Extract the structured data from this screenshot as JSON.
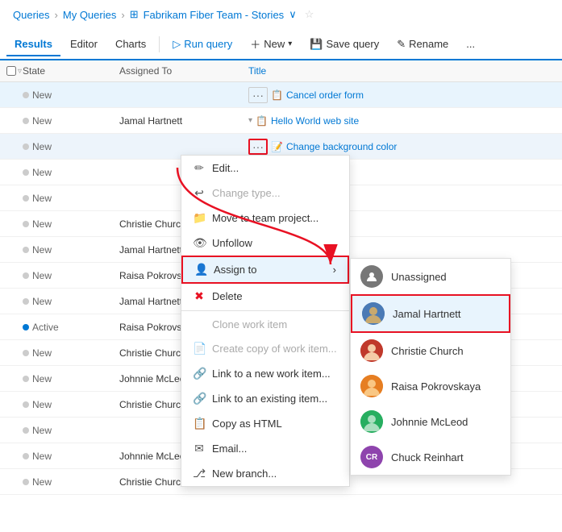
{
  "breadcrumb": {
    "item1": "Queries",
    "item2": "My Queries",
    "item3": "Fabrikam Fiber Team - Stories",
    "icon": "⊞"
  },
  "toolbar": {
    "results_tab": "Results",
    "editor_tab": "Editor",
    "charts_tab": "Charts",
    "run_query": "Run query",
    "new_label": "New",
    "save_query": "Save query",
    "rename": "Rename",
    "more": "..."
  },
  "table": {
    "col_state": "State",
    "col_assigned": "Assigned To",
    "col_title": "Title",
    "rows": [
      {
        "state": "New",
        "state_type": "grey",
        "assigned": "",
        "title": "Cancel order form",
        "icon": "story",
        "has_more": true
      },
      {
        "state": "New",
        "state_type": "grey",
        "assigned": "Jamal Hartnett",
        "title": "Hello World web site",
        "icon": "story",
        "has_more": false
      },
      {
        "state": "New",
        "state_type": "grey",
        "assigned": "",
        "title": "Change background color",
        "icon": "task",
        "has_more": true,
        "highlighted": true
      },
      {
        "state": "New",
        "state_type": "grey",
        "assigned": "",
        "title": "",
        "icon": "story",
        "has_more": false
      },
      {
        "state": "New",
        "state_type": "grey",
        "assigned": "",
        "title": "",
        "icon": "story",
        "has_more": false
      },
      {
        "state": "New",
        "state_type": "grey",
        "assigned": "Christie Church",
        "title": "",
        "icon": "story",
        "has_more": false
      },
      {
        "state": "New",
        "state_type": "grey",
        "assigned": "Jamal Hartnett",
        "title": "",
        "icon": "story",
        "has_more": false
      },
      {
        "state": "New",
        "state_type": "grey",
        "assigned": "Raisa Pokrovska...",
        "title": "",
        "icon": "story",
        "has_more": false
      },
      {
        "state": "New",
        "state_type": "grey",
        "assigned": "Jamal Hartnett",
        "title": "",
        "icon": "story",
        "has_more": false
      },
      {
        "state": "Active",
        "state_type": "blue",
        "assigned": "Raisa Pokrovska...",
        "title": "",
        "icon": "story",
        "has_more": false
      },
      {
        "state": "New",
        "state_type": "grey",
        "assigned": "Christie Church",
        "title": "",
        "icon": "story",
        "has_more": false
      },
      {
        "state": "New",
        "state_type": "grey",
        "assigned": "Johnnie McLeod...",
        "title": "",
        "icon": "story",
        "has_more": false
      },
      {
        "state": "New",
        "state_type": "grey",
        "assigned": "Christie Church",
        "title": "",
        "icon": "story",
        "has_more": false
      },
      {
        "state": "New",
        "state_type": "grey",
        "assigned": "",
        "title": "",
        "icon": "story",
        "has_more": false
      },
      {
        "state": "New",
        "state_type": "grey",
        "assigned": "Johnnie McLeod...",
        "title": "",
        "icon": "story",
        "has_more": false
      },
      {
        "state": "New",
        "state_type": "grey",
        "assigned": "Christie Church",
        "title": "",
        "icon": "story",
        "has_more": false
      }
    ]
  },
  "context_menu": {
    "edit": "Edit...",
    "change_type": "Change type...",
    "move_to_team": "Move to team project...",
    "unfollow": "Unfollow",
    "assign_to": "Assign to",
    "delete": "Delete",
    "clone_work_item": "Clone work item",
    "create_copy": "Create copy of work item...",
    "link_new": "Link to a new work item...",
    "link_existing": "Link to an existing item...",
    "copy_html": "Copy as HTML",
    "email": "Email...",
    "new_branch": "New branch..."
  },
  "assign_submenu": {
    "unassigned": "Unassigned",
    "jamal": "Jamal Hartnett",
    "christie": "Christie Church",
    "raisa": "Raisa Pokrovskaya",
    "johnnie": "Johnnie McLeod",
    "chuck": "Chuck Reinhart",
    "chuck_initials": "CR"
  }
}
